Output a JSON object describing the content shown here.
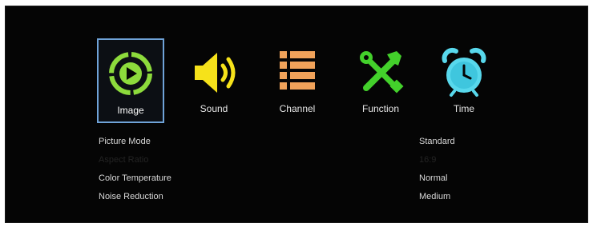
{
  "menu": {
    "tabs": [
      {
        "label": "Image",
        "icon": "play-circle-icon",
        "color": "#8ddb3c",
        "selected": true
      },
      {
        "label": "Sound",
        "icon": "speaker-icon",
        "color": "#f6e21a",
        "selected": false
      },
      {
        "label": "Channel",
        "icon": "list-icon",
        "color": "#f0a25a",
        "selected": false
      },
      {
        "label": "Function",
        "icon": "tools-icon",
        "color": "#43d02b",
        "selected": false
      },
      {
        "label": "Time",
        "icon": "alarm-clock-icon",
        "color": "#58d8ec",
        "selected": false
      }
    ]
  },
  "settings": [
    {
      "name": "Picture Mode",
      "value": "Standard",
      "enabled": true
    },
    {
      "name": "Aspect Ratio",
      "value": "16:9",
      "enabled": false
    },
    {
      "name": "Color Temperature",
      "value": "Normal",
      "enabled": true
    },
    {
      "name": "Noise Reduction",
      "value": "Medium",
      "enabled": true
    }
  ],
  "colors": {
    "background": "#050505",
    "selection_border": "#6fa3d8"
  }
}
